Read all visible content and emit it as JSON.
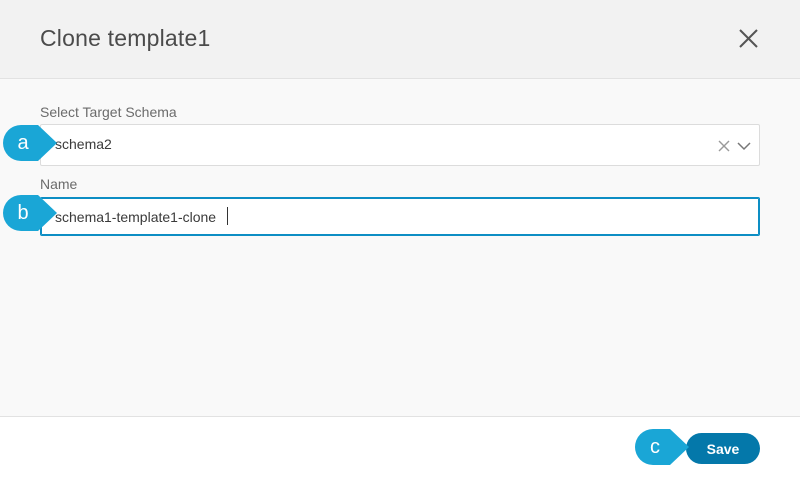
{
  "dialog": {
    "title": "Clone template1",
    "close_icon": "close-icon"
  },
  "form": {
    "schema_label": "Select Target Schema",
    "schema_value": "schema2",
    "schema_clear_icon": "clear-icon",
    "schema_dropdown_icon": "chevron-down-icon",
    "name_label": "Name",
    "name_value": "schema1-template1-clone"
  },
  "footer": {
    "save_label": "Save"
  },
  "callouts": [
    "a",
    "b",
    "c"
  ],
  "colors": {
    "accent": "#0478aa",
    "callout": "#1aa6d6",
    "focus_border": "#0d8ec4"
  }
}
